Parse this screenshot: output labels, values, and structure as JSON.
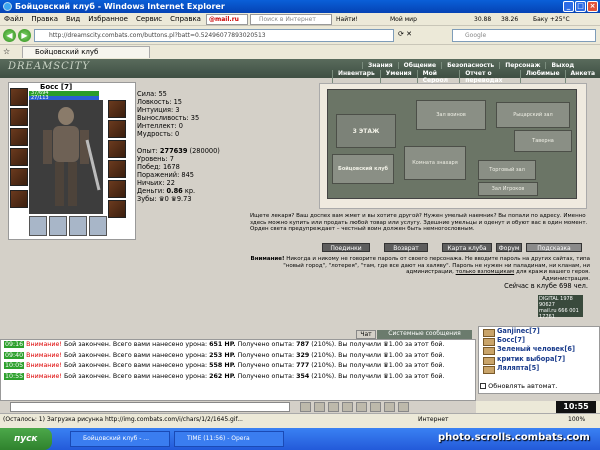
{
  "window": {
    "title": "Бойцовский клуб - Windows Internet Explorer"
  },
  "menu": [
    "Файл",
    "Правка",
    "Вид",
    "Избранное",
    "Сервис",
    "Справка"
  ],
  "toolbar": {
    "mail_label": "@mail.ru",
    "search_placeholder": "Поиск в Интернет",
    "find_label": "Найти!",
    "mymir_label": "Мой мир",
    "stock1": "30.88",
    "stock2": "38.26",
    "weather": "Баку +25°C"
  },
  "address": {
    "url": "http://dreamscity.combats.com/buttons.pl?batt=0.52496077893020513",
    "google_placeholder": "Google"
  },
  "tab": {
    "label": "Бойцовский клуб"
  },
  "site": {
    "logo": "DREAMSCITY",
    "nav_top": [
      "Знания",
      "Общение",
      "Безопасность",
      "Персонаж",
      "Выход"
    ],
    "nav_bottom": [
      "Инвентарь",
      "Умения",
      "Мой Сероол",
      "Отчет о переводах",
      "Любимые",
      "Анкета"
    ]
  },
  "character": {
    "name": "Босс [7]",
    "hp": "37/694",
    "mana": "27/113",
    "stats": [
      {
        "label": "Сила: 55"
      },
      {
        "label": "Ловкость: 15"
      },
      {
        "label": "Интуиция: 3"
      },
      {
        "label": "Выносливость: 35"
      },
      {
        "label": "Интеллект: 0"
      },
      {
        "label": "Мудрость: 0"
      }
    ],
    "exp_label": "Опыт:",
    "exp_value": "277639",
    "exp_next": "(280000)",
    "level": "Уровень: 7",
    "wins": "Побед: 1678",
    "losses": "Поражений: 845",
    "draws": "Ничьих: 22",
    "money_label": "Деньги:",
    "money_value": "0.86",
    "money_unit": "кр.",
    "teeth": "Зубы: ♛0 ♛9.73"
  },
  "map": {
    "rooms": [
      "3 ЭТАЖ",
      "Зал воинов",
      "Рыцарский зал",
      "Бойцовский клуб",
      "Комната знахаря",
      "Торговый зал",
      "Таверна",
      "Зал Игроков"
    ]
  },
  "info": {
    "text": "Ищете лекаря? Ваш доспех вам жмет и вы хотите другой? Нужен умелый наемник? Вы попали по адресу. Именно здесь можно купить или продать любой товар или услугу. Здешние умельцы и оденут и обуют вас в один момент. Орден света предупреждает – честный воин должен быть немногословным."
  },
  "actions": [
    "Поединки",
    "Возврат",
    "Карта клуба",
    "Форум",
    "Подсказка"
  ],
  "warning": {
    "lead": "Внимание!",
    "text": "Никогда и никому не говорите пароль от своего персонажа. Не вводите пароль на других сайтах, типа \"новый город\", \"лотерея\", \"там, где все дают на халяву\". Пароль не нужен ни паладинам, ни кланам, ни администрации,",
    "link": "только взломщикам",
    "tail": "для кражи вашего героя.",
    "sign": "Администрация."
  },
  "online": "Сейчас в клубе 698 чел.",
  "counter": {
    "l1": "DIGITAL 1978 90627",
    "l2": "mail.ru 666 001",
    "l3": "17761"
  },
  "chat": {
    "tabs": [
      "Чат",
      "Системные сообщения"
    ],
    "lines": [
      {
        "time": "09:16",
        "warn": "Внимание!",
        "text": "Бой закончен. Всего вами нанесено урона:",
        "dmg": "651 HP.",
        "rest": "Получено опыта:",
        "xp": "787",
        "pct": "(210%). Вы получили",
        "money": "♛1.00",
        "tail": "за этот бой."
      },
      {
        "time": "09:40",
        "warn": "Внимание!",
        "text": "Бой закончен. Всего вами нанесено урона:",
        "dmg": "253 HP.",
        "rest": "Получено опыта:",
        "xp": "329",
        "pct": "(210%). Вы получили",
        "money": "♛1.00",
        "tail": "за этот бой."
      },
      {
        "time": "10:05",
        "warn": "Внимание!",
        "text": "Бой закончен. Всего вами нанесено урона:",
        "dmg": "558 HP.",
        "rest": "Получено опыта:",
        "xp": "777",
        "pct": "(210%). Вы получили",
        "money": "♛1.00",
        "tail": "за этот бой."
      },
      {
        "time": "10:55",
        "warn": "Внимание!",
        "text": "Бой закончен. Всего вами нанесено урона:",
        "dmg": "262 HP.",
        "rest": "Получено опыта:",
        "xp": "354",
        "pct": "(210%). Вы получили",
        "money": "♛1.00",
        "tail": "за этот бой."
      }
    ]
  },
  "players": [
    "Ganjinec[7]",
    "Босс[7]",
    "Зеленый человек[6]",
    "критик выбора[7]",
    "Ляляпта[5]"
  ],
  "refresh_label": "Обновлять автомат.",
  "clock": "10:55",
  "status": {
    "text": "(Осталось: 1) Загрузка рисунка http://img.combats.com/i/chars/1/2/1645.gif...",
    "zone": "Интернет",
    "zoom": "100%"
  },
  "taskbar": {
    "start": "пуск",
    "tasks": [
      "Бойцовский клуб - ...",
      "TIME (11:56) - Opera"
    ]
  },
  "watermark": "photo.scrolls.combats.com"
}
